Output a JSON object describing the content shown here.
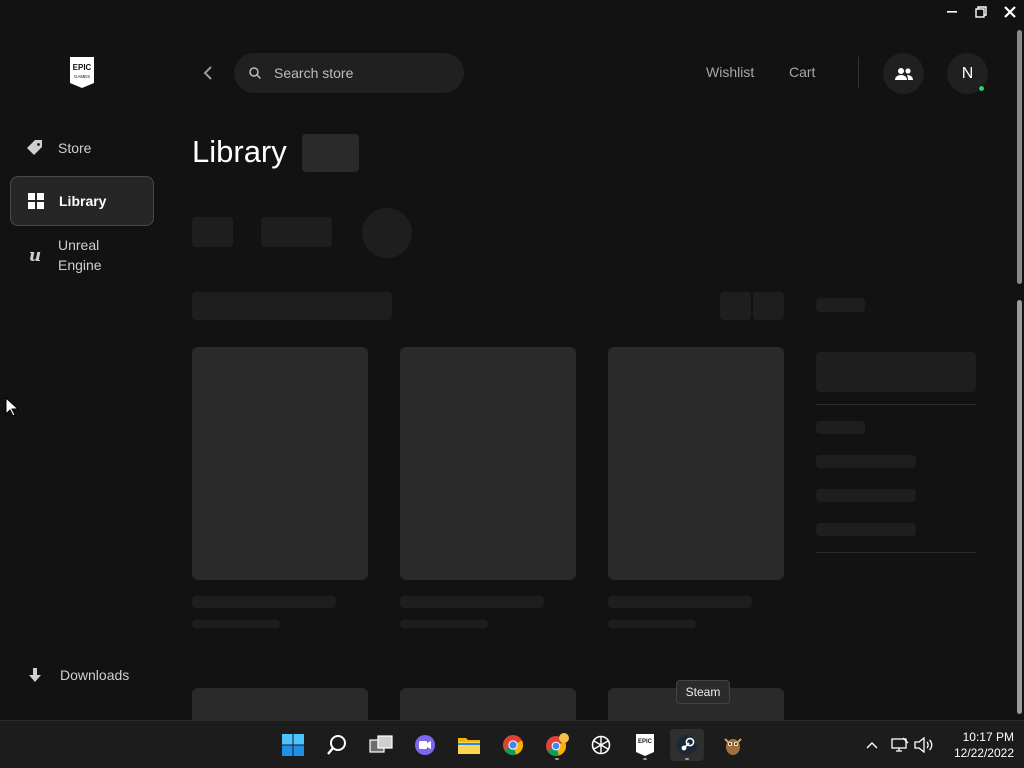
{
  "window": {
    "controls": [
      "minimize",
      "restore",
      "close"
    ]
  },
  "sidebar": {
    "logo_text_top": "EPIC",
    "logo_text_bottom": "GAMES",
    "items": [
      {
        "label": "Store",
        "icon": "tag-icon",
        "active": false
      },
      {
        "label": "Library",
        "icon": "grid-icon",
        "active": true
      },
      {
        "label": "Unreal Engine",
        "icon": "unreal-icon",
        "active": false
      }
    ],
    "downloads_label": "Downloads"
  },
  "header": {
    "search_placeholder": "Search store",
    "wishlist_label": "Wishlist",
    "cart_label": "Cart",
    "avatar_initial": "N"
  },
  "main": {
    "title": "Library"
  },
  "tooltip": {
    "text": "Steam"
  },
  "taskbar": {
    "apps": [
      "windows-start",
      "search",
      "task-view",
      "teams-chat",
      "file-explorer",
      "chrome",
      "chrome-canary",
      "chatgpt",
      "epic-games",
      "steam",
      "game"
    ],
    "active_app": "steam",
    "time": "10:17 PM",
    "date": "12/22/2022"
  },
  "colors": {
    "background": "#121212",
    "skeleton": "#2a2a2a",
    "online": "#2ecc71"
  }
}
